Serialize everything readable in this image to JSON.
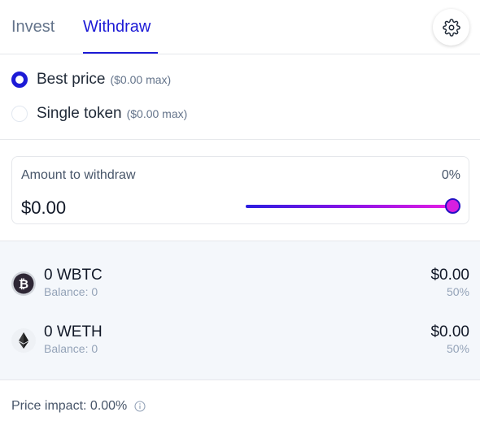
{
  "tabs": [
    {
      "label": "Invest",
      "active": false
    },
    {
      "label": "Withdraw",
      "active": true
    }
  ],
  "settings": {
    "icon": "gear-icon"
  },
  "options": [
    {
      "label": "Best price",
      "max": "($0.00 max)",
      "selected": true
    },
    {
      "label": "Single token",
      "max": "($0.00 max)",
      "selected": false
    }
  ],
  "amount": {
    "label": "Amount to withdraw",
    "percent": "0%",
    "value": "$0.00",
    "slider_fraction": 1.0
  },
  "tokens": [
    {
      "icon": "bitcoin-icon",
      "amount": "0 WBTC",
      "balance": "Balance: 0",
      "value": "$0.00",
      "share": "50%"
    },
    {
      "icon": "ethereum-icon",
      "amount": "0 WETH",
      "balance": "Balance: 0",
      "value": "$0.00",
      "share": "50%"
    }
  ],
  "price_impact": {
    "label": "Price impact: 0.00%",
    "icon": "info-icon"
  },
  "colors": {
    "accent": "#1d1bd6",
    "slider_start": "#2b1ee0",
    "slider_end": "#e81ee3",
    "token_bg": "#f4f7fb"
  }
}
